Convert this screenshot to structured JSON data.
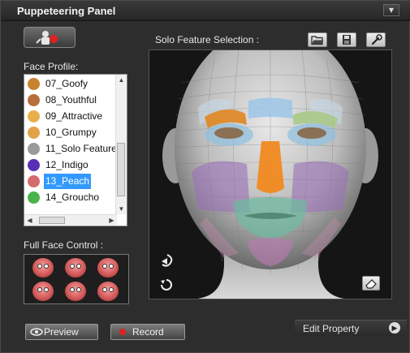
{
  "window": {
    "title": "Puppeteering Panel",
    "close_label": "▾"
  },
  "labels": {
    "face_profile": "Face Profile:",
    "full_face_control": "Full Face Control :",
    "solo_feature_selection": "Solo Feature Selection :"
  },
  "profiles": [
    {
      "label": "07_Goofy",
      "icon_color": "#c8832e"
    },
    {
      "label": "08_Youthful",
      "icon_color": "#b86e3a"
    },
    {
      "label": "09_Attractive",
      "icon_color": "#e8b04a"
    },
    {
      "label": "10_Grumpy",
      "icon_color": "#e2a24a"
    },
    {
      "label": "11_Solo Feature",
      "icon_color": "#9a9a9a"
    },
    {
      "label": "12_Indigo",
      "icon_color": "#5a2fb8"
    },
    {
      "label": "13_Peach",
      "icon_color": "#d46b6b",
      "selected": true
    },
    {
      "label": "14_Groucho",
      "icon_color": "#49b24a"
    }
  ],
  "buttons": {
    "preview": "Preview",
    "record": "Record",
    "edit_property": "Edit Property"
  },
  "icons": {
    "puppet_record": "puppet-record-icon",
    "open_folder": "open-folder-icon",
    "save": "save-icon",
    "settings": "wrench-icon",
    "rotate_head": "rotate-head-icon",
    "reset": "reset-icon",
    "eraser": "eraser-icon",
    "preview": "eye-icon",
    "record": "record-dot-icon",
    "arrow": "play-arrow-icon"
  },
  "colors": {
    "accent_selected": "#3399ff",
    "record_red": "#e02020",
    "brow": "#e08a2a",
    "nose": "#f08a20",
    "cheek": "#9a6fb5",
    "mouth": "#6fb8a0",
    "eyes": "#8fc0e0"
  }
}
